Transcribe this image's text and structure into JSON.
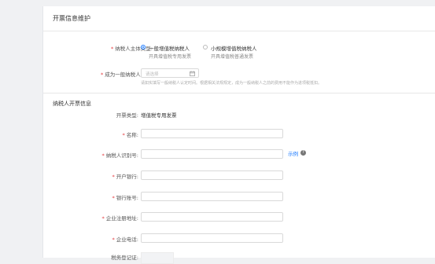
{
  "header": {
    "title": "开票信息维护"
  },
  "taxpayer_type": {
    "label": "纳税人主体类型:",
    "options": [
      {
        "title": "一般增值税纳税人",
        "sub": "开具增值税专用发票",
        "selected": true
      },
      {
        "title": "小规模增值税纳税人",
        "sub": "开具增值税普通发票",
        "selected": false
      }
    ]
  },
  "general_time": {
    "label": "成为一般纳税人时间:",
    "placeholder": "请选择",
    "hint": "请如实填写一般纳税人认定时间。根据相关法规规定，成为一般纳税人之前的费用不能作为进项税抵扣。"
  },
  "section": {
    "title": "纳税人开票信息"
  },
  "invoice_type": {
    "label": "开票类型:",
    "value": "增值税专用发票"
  },
  "fields": {
    "name": {
      "label": "名称:"
    },
    "tax_id": {
      "label": "纳税人识别号:",
      "example": "示例",
      "help": "?"
    },
    "bank": {
      "label": "开户银行:"
    },
    "account": {
      "label": "银行账号:"
    },
    "address": {
      "label": "企业注册地址:"
    },
    "phone": {
      "label": "企业电话:"
    },
    "tax_cert": {
      "label": "税务登记证:"
    }
  },
  "colors": {
    "accent": "#1677ff",
    "required": "#e4393c"
  }
}
